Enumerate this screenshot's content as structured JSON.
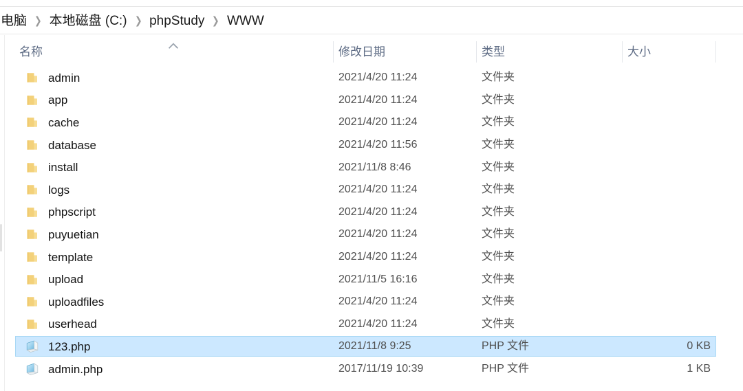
{
  "window": {
    "app": "file-explorer",
    "selection_color": "#cce8ff",
    "folder_icon_color": "#f3d17a",
    "php_icon_color": "#9fd4ef",
    "header_text_color": "#5d6b84"
  },
  "breadcrumb": {
    "name": "address-bar",
    "segments": [
      {
        "label": "电脑"
      },
      {
        "label": "本地磁盘 (C:)"
      },
      {
        "label": "phpStudy"
      },
      {
        "label": "WWW"
      }
    ],
    "separator": "❯"
  },
  "columns": [
    {
      "key": "name",
      "label": "名称",
      "sorted": "asc",
      "sort_glyph": "^"
    },
    {
      "key": "date",
      "label": "修改日期",
      "sorted": "none"
    },
    {
      "key": "type",
      "label": "类型",
      "sorted": "none"
    },
    {
      "key": "size",
      "label": "大小",
      "sorted": "none"
    }
  ],
  "files": [
    {
      "name": "admin",
      "date": "2021/4/20 11:24",
      "type": "文件夹",
      "size": "",
      "icon": "folder-icon",
      "selected": false
    },
    {
      "name": "app",
      "date": "2021/4/20 11:24",
      "type": "文件夹",
      "size": "",
      "icon": "folder-icon",
      "selected": false
    },
    {
      "name": "cache",
      "date": "2021/4/20 11:24",
      "type": "文件夹",
      "size": "",
      "icon": "folder-icon",
      "selected": false
    },
    {
      "name": "database",
      "date": "2021/4/20 11:56",
      "type": "文件夹",
      "size": "",
      "icon": "folder-icon",
      "selected": false
    },
    {
      "name": "install",
      "date": "2021/11/8 8:46",
      "type": "文件夹",
      "size": "",
      "icon": "folder-icon",
      "selected": false
    },
    {
      "name": "logs",
      "date": "2021/4/20 11:24",
      "type": "文件夹",
      "size": "",
      "icon": "folder-icon",
      "selected": false
    },
    {
      "name": "phpscript",
      "date": "2021/4/20 11:24",
      "type": "文件夹",
      "size": "",
      "icon": "folder-icon",
      "selected": false
    },
    {
      "name": "puyuetian",
      "date": "2021/4/20 11:24",
      "type": "文件夹",
      "size": "",
      "icon": "folder-icon",
      "selected": false
    },
    {
      "name": "template",
      "date": "2021/4/20 11:24",
      "type": "文件夹",
      "size": "",
      "icon": "folder-icon",
      "selected": false
    },
    {
      "name": "upload",
      "date": "2021/11/5 16:16",
      "type": "文件夹",
      "size": "",
      "icon": "folder-icon",
      "selected": false
    },
    {
      "name": "uploadfiles",
      "date": "2021/4/20 11:24",
      "type": "文件夹",
      "size": "",
      "icon": "folder-icon",
      "selected": false
    },
    {
      "name": "userhead",
      "date": "2021/4/20 11:24",
      "type": "文件夹",
      "size": "",
      "icon": "folder-icon",
      "selected": false
    },
    {
      "name": "123.php",
      "date": "2021/11/8 9:25",
      "type": "PHP 文件",
      "size": "0 KB",
      "icon": "php-file-icon",
      "selected": true
    },
    {
      "name": "admin.php",
      "date": "2017/11/19 10:39",
      "type": "PHP 文件",
      "size": "1 KB",
      "icon": "php-file-icon",
      "selected": false
    }
  ]
}
